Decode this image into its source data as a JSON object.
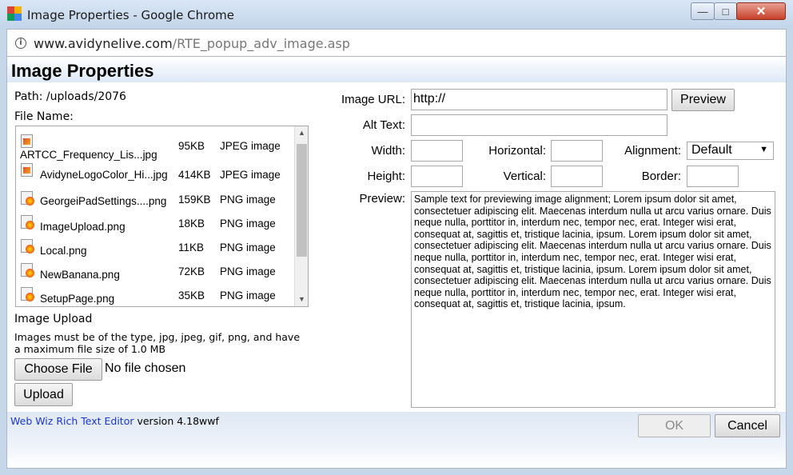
{
  "window": {
    "title": "Image Properties - Google Chrome",
    "minimize_glyph": "—",
    "maximize_glyph": "□",
    "close_glyph": "✕",
    "url_host": "www.avidynelive.com",
    "url_path": "/RTE_popup_adv_image.asp",
    "info_glyph": "i"
  },
  "page": {
    "title": "Image Properties",
    "path_label": "Path: /uploads/2076",
    "file_name_label": "File Name:",
    "files": [
      {
        "name": "ARTCC_Frequency_Lis...jpg",
        "size": "95KB",
        "type": "JPEG image",
        "icon": "jpg-file-icon"
      },
      {
        "name": "AvidyneLogoColor_Hi...jpg",
        "size": "414KB",
        "type": "JPEG image",
        "icon": "jpg-file-icon"
      },
      {
        "name": "GeorgeiPadSettings....png",
        "size": "159KB",
        "type": "PNG image",
        "icon": "png-file-icon"
      },
      {
        "name": "ImageUpload.png",
        "size": "18KB",
        "type": "PNG image",
        "icon": "png-file-icon"
      },
      {
        "name": "Local.png",
        "size": "11KB",
        "type": "PNG image",
        "icon": "png-file-icon"
      },
      {
        "name": "NewBanana.png",
        "size": "72KB",
        "type": "PNG image",
        "icon": "png-file-icon"
      },
      {
        "name": "SetupPage.png",
        "size": "35KB",
        "type": "PNG image",
        "icon": "png-file-icon"
      }
    ],
    "scroll_up_glyph": "▲",
    "scroll_down_glyph": "▼",
    "upload_heading": "Image Upload",
    "upload_note_1": "Images must be of the type, jpg, jpeg, gif, png, and have",
    "upload_note_2": "a maximum file size of 1.0 MB",
    "choose_file_label": "Choose File",
    "no_file_text": "No file chosen",
    "upload_label": "Upload",
    "image_url_label": "Image URL:",
    "image_url_value": "http://",
    "preview_button_label": "Preview",
    "alt_text_label": "Alt Text:",
    "alt_text_value": "",
    "width_label": "Width:",
    "height_label": "Height:",
    "horizontal_label": "Horizontal:",
    "vertical_label": "Vertical:",
    "alignment_label": "Alignment:",
    "alignment_value": "Default",
    "border_label": "Border:",
    "preview_label": "Preview:",
    "preview_text": "Sample text for previewing image alignment; Lorem ipsum dolor sit amet, consectetuer adipiscing elit. Maecenas interdum nulla ut arcu varius ornare. Duis neque nulla, porttitor in, interdum nec, tempor nec, erat. Integer wisi erat, consequat at, sagittis et, tristique lacinia, ipsum. Lorem ipsum dolor sit amet, consectetuer adipiscing elit. Maecenas interdum nulla ut arcu varius ornare. Duis neque nulla, porttitor in, interdum nec, tempor nec, erat. Integer wisi erat, consequat at, sagittis et, tristique lacinia, ipsum. Lorem ipsum dolor sit amet, consectetuer adipiscing elit. Maecenas interdum nulla ut arcu varius ornare. Duis neque nulla, porttitor in, interdum nec, tempor nec, erat. Integer wisi erat, consequat at, sagittis et, tristique lacinia, ipsum.",
    "footer_link": "Web Wiz Rich Text Editor",
    "footer_version": " version 4.18wwf",
    "ok_label": "OK",
    "cancel_label": "Cancel"
  },
  "colors": {
    "link": "#1a37c8",
    "frame": "#c6d7ea"
  }
}
